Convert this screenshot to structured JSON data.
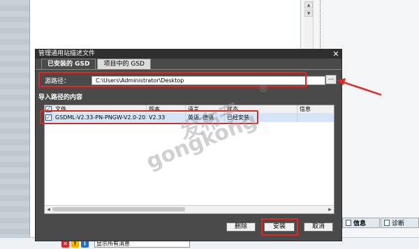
{
  "dialog": {
    "title": "管理通用站描述文件",
    "close": "✕",
    "tabs": [
      {
        "label": "已安装的 GSD",
        "active": true
      },
      {
        "label": "项目中的 GSD",
        "active": false
      }
    ],
    "source_path_label": "源路径：",
    "source_path_value": "C:\\Users\\Administrator\\Desktop",
    "browse_label": "...",
    "section_title": "导入路径的内容",
    "table": {
      "columns": [
        "文件",
        "版本",
        "语言",
        "状态",
        "信息"
      ],
      "rows": [
        {
          "checked": true,
          "file": "GSDML-V2.33-PN-PNGW-V2.0-202...",
          "version": "V2.33",
          "language": "英语, 德语",
          "status": "已经安装",
          "info": ""
        }
      ]
    },
    "buttons": {
      "delete": "删除",
      "install": "安装",
      "cancel": "取消"
    }
  },
  "background": {
    "panel_tabs": [
      {
        "label": "信息",
        "icon": "info-icon"
      },
      {
        "label": "诊断",
        "icon": "diagnostics-icon"
      }
    ],
    "status_filter": "显示所有消息"
  },
  "watermark": {
    "top": "发布于",
    "bottom": "gongkong",
    "mark": "®"
  },
  "colors": {
    "highlight": "#e8241f",
    "dialog_bg": "#4a4a4a",
    "selected_row": "#d5e5f7"
  }
}
